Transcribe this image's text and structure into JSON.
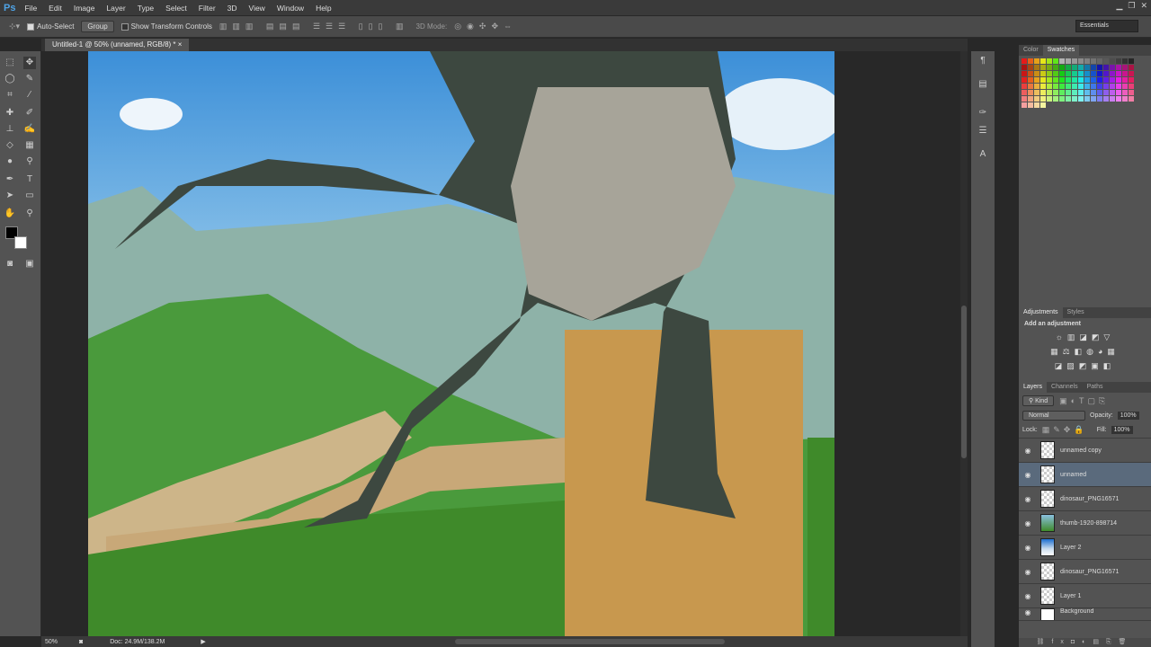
{
  "app": {
    "logo": "Ps",
    "menu": [
      "File",
      "Edit",
      "Image",
      "Layer",
      "Type",
      "Select",
      "Filter",
      "3D",
      "View",
      "Window",
      "Help"
    ],
    "workspace": "Essentials"
  },
  "options": {
    "auto_select": "Auto-Select",
    "group": "Group",
    "show_transform": "Show Transform Controls",
    "mode_3d": "3D Mode:"
  },
  "document": {
    "tab": "Untitled-1 @ 50% (unnamed, RGB/8) *",
    "close": "×"
  },
  "status": {
    "zoom": "50%",
    "doc": "Doc: 24.9M/138.2M"
  },
  "color_panel": {
    "tabs": [
      "Color",
      "Swatches"
    ]
  },
  "adjustments": {
    "tabs": [
      "Adjustments",
      "Styles"
    ],
    "heading": "Add an adjustment"
  },
  "layers_panel": {
    "tabs": [
      "Layers",
      "Channels",
      "Paths"
    ],
    "kind": "Kind",
    "blend": "Normal",
    "opacity_label": "Opacity:",
    "opacity": "100%",
    "lock_label": "Lock:",
    "fill_label": "Fill:",
    "fill": "100%",
    "layers": [
      {
        "name": "unnamed copy"
      },
      {
        "name": "unnamed",
        "selected": true
      },
      {
        "name": "dinosaur_PNG16571"
      },
      {
        "name": "thumb-1920-898714"
      },
      {
        "name": "Layer 2"
      },
      {
        "name": "dinosaur_PNG16571"
      },
      {
        "name": "Layer 1"
      },
      {
        "name": "Background"
      }
    ]
  }
}
